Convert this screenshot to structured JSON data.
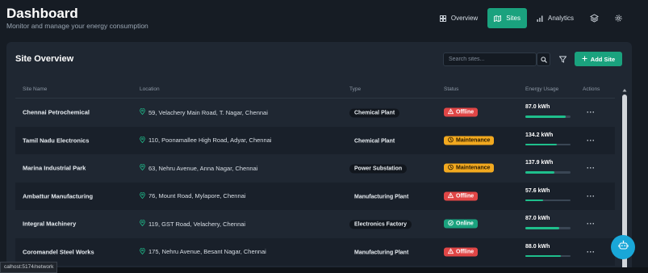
{
  "header": {
    "title": "Dashboard",
    "subtitle": "Monitor and manage your energy consumption",
    "nav": [
      {
        "label": "Overview",
        "icon": "grid-icon",
        "active": false
      },
      {
        "label": "Sites",
        "icon": "map-icon",
        "active": true
      },
      {
        "label": "Analytics",
        "icon": "bar-chart-icon",
        "active": false
      }
    ],
    "icons": [
      "layers-icon",
      "gear-icon"
    ]
  },
  "card": {
    "title": "Site Overview",
    "search_placeholder": "Search sites...",
    "add_label": "Add Site"
  },
  "table": {
    "columns": [
      "Site Name",
      "Location",
      "Type",
      "Status",
      "Energy Usage",
      "Actions"
    ],
    "rows": [
      {
        "name": "Chennai Petrochemical",
        "location": "59, Velachery Main Road, T. Nagar, Chennai",
        "type": "Chemical Plant",
        "type_pill": true,
        "status": "Offline",
        "status_kind": "offline",
        "energy": "87.0 kWh",
        "energy_fraction": 0.9
      },
      {
        "name": "Tamil Nadu Electronics",
        "location": "110, Poonamallee High Road, Adyar, Chennai",
        "type": "Chemical Plant",
        "type_pill": false,
        "status": "Maintenance",
        "status_kind": "maintenance",
        "energy": "134.2 kWh",
        "energy_fraction": 0.7
      },
      {
        "name": "Marina Industrial Park",
        "location": "63, Nehru Avenue, Anna Nagar, Chennai",
        "type": "Power Substation",
        "type_pill": true,
        "status": "Maintenance",
        "status_kind": "maintenance",
        "energy": "137.9 kWh",
        "energy_fraction": 0.65
      },
      {
        "name": "Ambattur Manufacturing",
        "location": "76, Mount Road, Mylapore, Chennai",
        "type": "Manufacturing Plant",
        "type_pill": false,
        "status": "Offline",
        "status_kind": "offline",
        "energy": "57.6 kWh",
        "energy_fraction": 0.4
      },
      {
        "name": "Integral Machinery",
        "location": "119, GST Road, Velachery, Chennai",
        "type": "Electronics Factory",
        "type_pill": true,
        "status": "Online",
        "status_kind": "online",
        "energy": "87.0 kWh",
        "energy_fraction": 0.75
      },
      {
        "name": "Coromandel Steel Works",
        "location": "175, Nehru Avenue, Besant Nagar, Chennai",
        "type": "Manufacturing Plant",
        "type_pill": false,
        "status": "Offline",
        "status_kind": "offline",
        "energy": "88.0 kWh",
        "energy_fraction": 0.78
      }
    ],
    "actions_label": "···"
  },
  "statusbar": {
    "url": "calhost:5174/network"
  },
  "colors": {
    "accent": "#1aa27e",
    "offline": "#e04646",
    "maintenance": "#f2a91f",
    "online": "#1aa27e",
    "fab": "#19a7d8"
  }
}
